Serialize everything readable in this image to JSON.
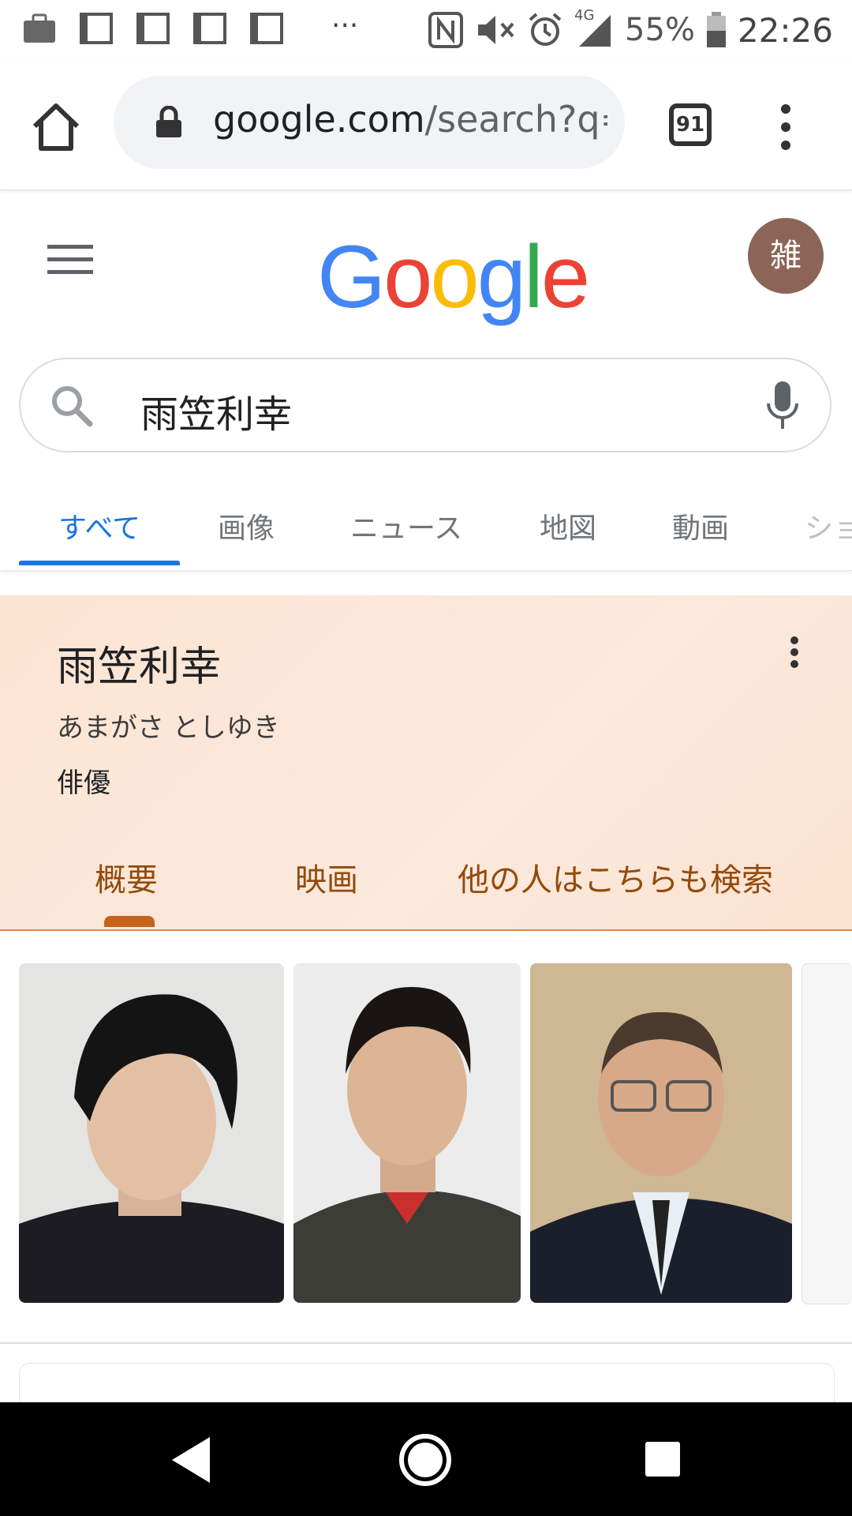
{
  "status_bar": {
    "battery": "55%",
    "time": "22:26",
    "network": "4G",
    "more": "···"
  },
  "browser": {
    "url_host": "google.com",
    "url_path": "/search?q=",
    "tab_count": "91"
  },
  "google": {
    "logo_letters": [
      "G",
      "o",
      "o",
      "g",
      "l",
      "e"
    ],
    "logo_colors": [
      "#4285F4",
      "#EA4335",
      "#FBBC05",
      "#4285F4",
      "#34A853",
      "#EA4335"
    ],
    "avatar_label": "雑",
    "avatar_color": "#8d6458"
  },
  "search": {
    "query": "雨笠利幸"
  },
  "tabs": [
    {
      "label": "すべて",
      "active": true
    },
    {
      "label": "画像"
    },
    {
      "label": "ニュース"
    },
    {
      "label": "地図"
    },
    {
      "label": "動画"
    },
    {
      "label": "ショ"
    }
  ],
  "knowledge_panel": {
    "title": "雨笠利幸",
    "reading": "あまがさ としゆき",
    "type": "俳優",
    "tabs": [
      "概要",
      "映画",
      "他の人はこちらも検索"
    ],
    "accent_color": "#c5621b"
  },
  "images": [
    {
      "name": "photo-1"
    },
    {
      "name": "photo-2"
    },
    {
      "name": "photo-3"
    }
  ]
}
